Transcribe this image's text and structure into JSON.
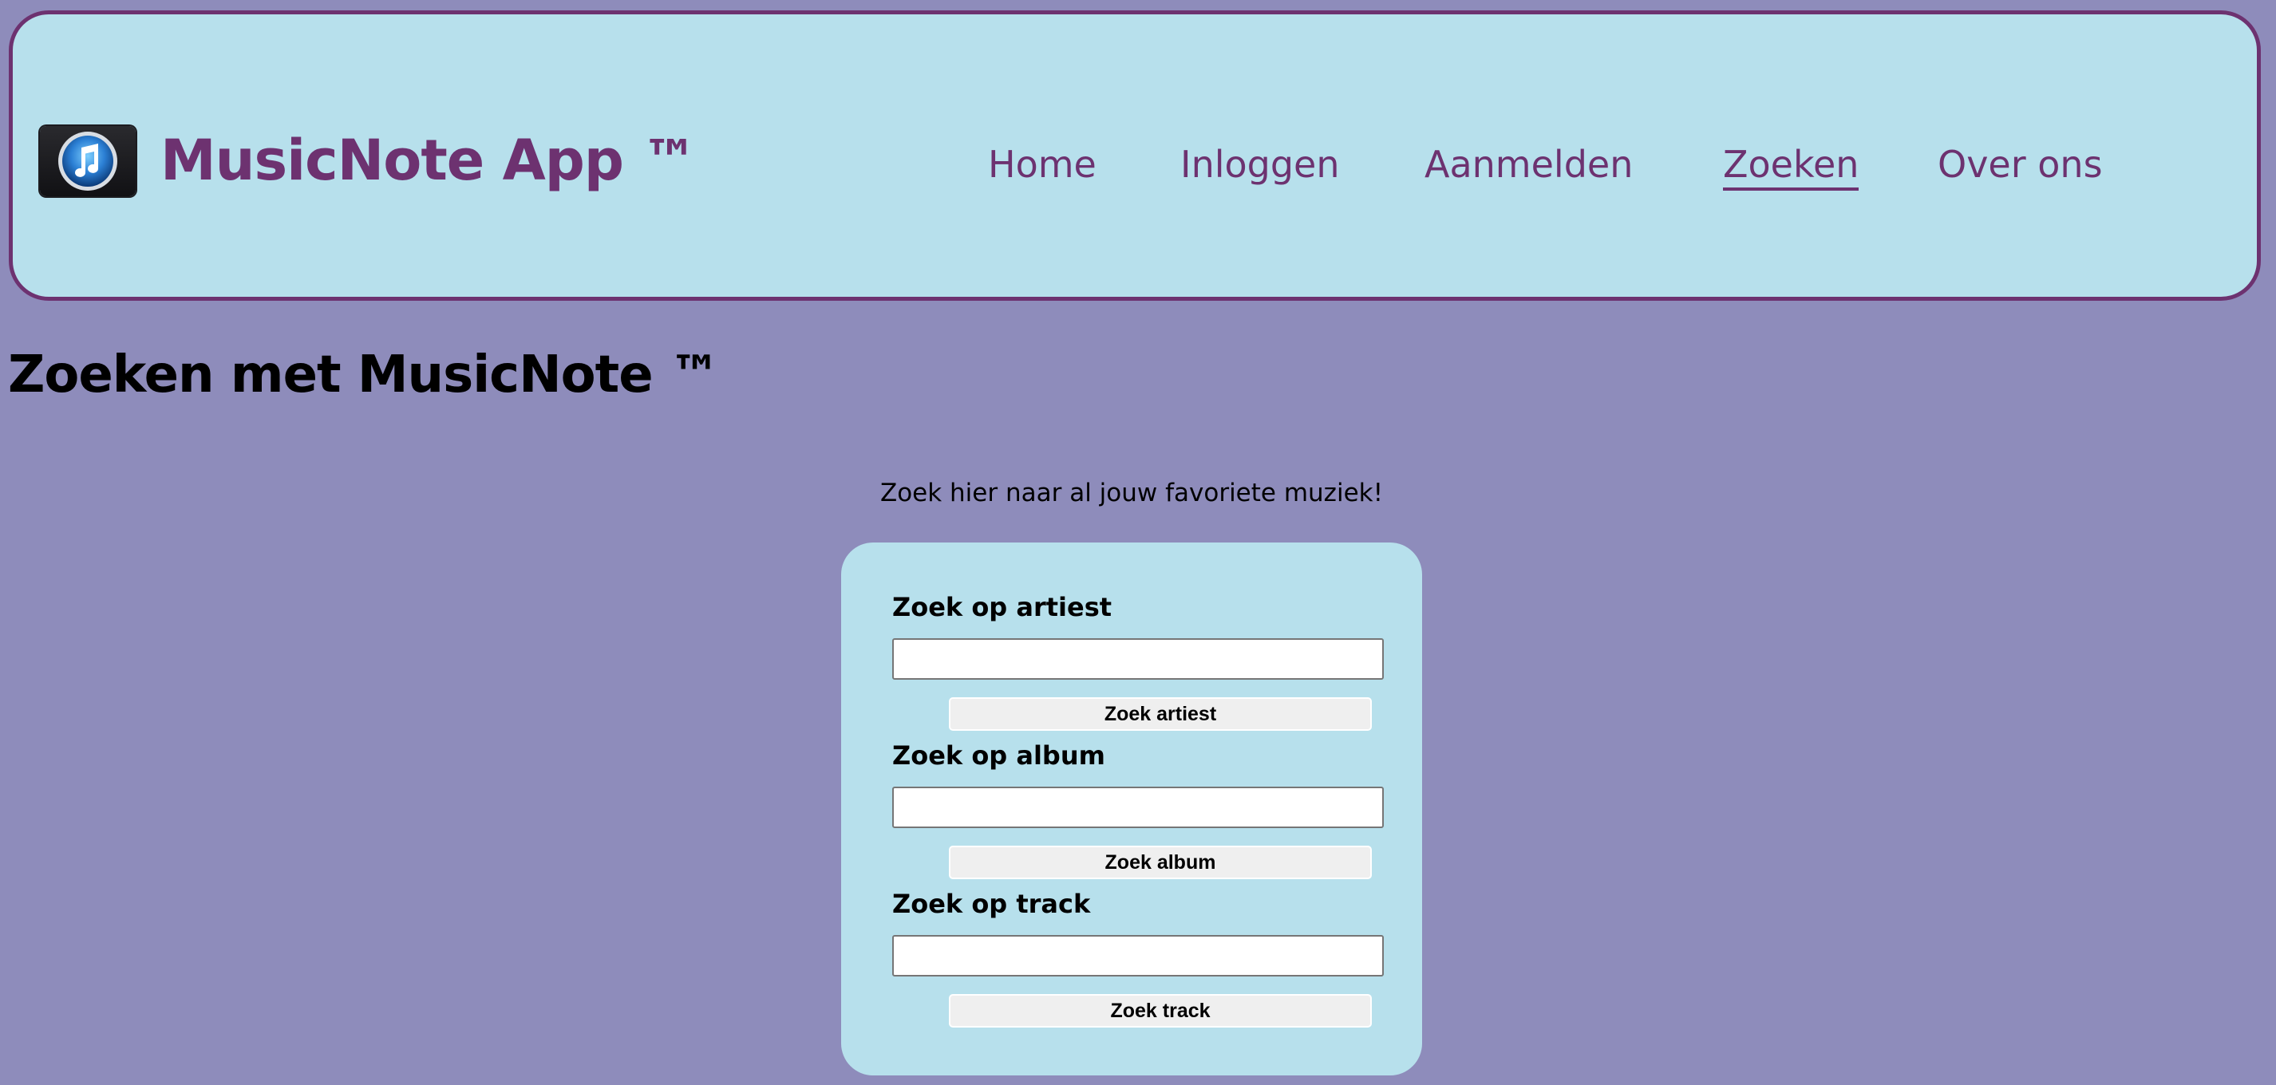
{
  "header": {
    "logo_icon": "itunes-music-note-icon",
    "brand": "MusicNote App ™",
    "colors": {
      "header_bg": "#b7e0ec",
      "border": "#6d3270",
      "link": "#6d3270"
    },
    "nav": [
      {
        "label": "Home",
        "active": false
      },
      {
        "label": "Inloggen",
        "active": false
      },
      {
        "label": "Aanmelden",
        "active": false
      },
      {
        "label": "Zoeken",
        "active": true
      },
      {
        "label": "Over ons",
        "active": false
      }
    ]
  },
  "page": {
    "background": "#8e8cbb",
    "title": "Zoeken met MusicNote ™",
    "intro": "Zoek hier naar al jouw favoriete muziek!"
  },
  "search": {
    "card_bg": "#b7e0ec",
    "artist": {
      "label": "Zoek op artiest",
      "value": "",
      "button": "Zoek artiest"
    },
    "album": {
      "label": "Zoek op album",
      "value": "",
      "button": "Zoek album"
    },
    "track": {
      "label": "Zoek op track",
      "value": "",
      "button": "Zoek track"
    }
  }
}
